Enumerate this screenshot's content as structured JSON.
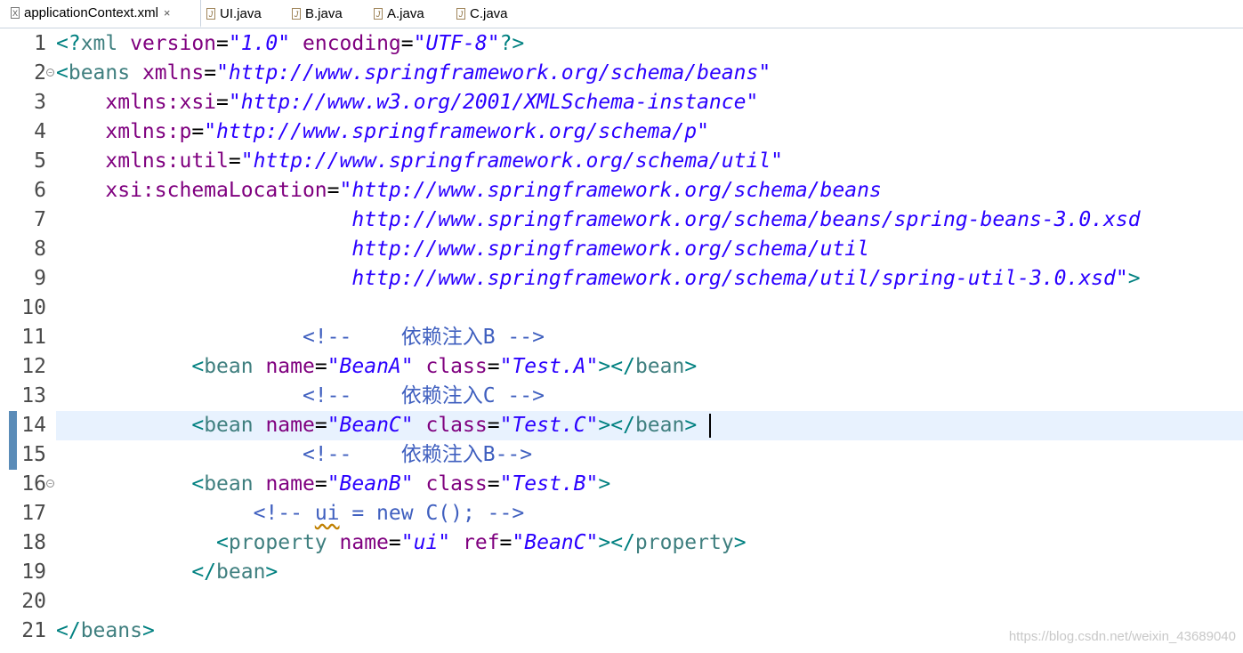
{
  "tabs": [
    {
      "label": "applicationContext.xml",
      "icon": "xml-file-icon",
      "active": true,
      "close": "×"
    },
    {
      "label": "UI.java",
      "icon": "java-file-icon"
    },
    {
      "label": "B.java",
      "icon": "java-file-icon"
    },
    {
      "label": "A.java",
      "icon": "java-file-icon"
    },
    {
      "label": "C.java",
      "icon": "java-file-icon"
    }
  ],
  "editor": {
    "current_line": 14,
    "line_numbers": [
      "1",
      "2",
      "3",
      "4",
      "5",
      "6",
      "7",
      "8",
      "9",
      "10",
      "11",
      "12",
      "13",
      "14",
      "15",
      "16",
      "17",
      "18",
      "19",
      "20",
      "21"
    ],
    "lines": [
      [
        [
          "bracket",
          "<?"
        ],
        [
          "tag",
          "xml "
        ],
        [
          "attr",
          "version"
        ],
        [
          "eq",
          "="
        ],
        [
          "str",
          "\"1.0\""
        ],
        [
          "plain",
          " "
        ],
        [
          "attr",
          "encoding"
        ],
        [
          "eq",
          "="
        ],
        [
          "str",
          "\"UTF-8\""
        ],
        [
          "bracket",
          "?>"
        ]
      ],
      [
        [
          "bracket",
          "<"
        ],
        [
          "tag",
          "beans "
        ],
        [
          "attr",
          "xmlns"
        ],
        [
          "eq",
          "="
        ],
        [
          "str",
          "\"http://www.springframework.org/schema/beans\""
        ]
      ],
      [
        [
          "plain",
          "    "
        ],
        [
          "attr",
          "xmlns:xsi"
        ],
        [
          "eq",
          "="
        ],
        [
          "str",
          "\"http://www.w3.org/2001/XMLSchema-instance\""
        ]
      ],
      [
        [
          "plain",
          "    "
        ],
        [
          "attr",
          "xmlns:p"
        ],
        [
          "eq",
          "="
        ],
        [
          "str",
          "\"http://www.springframework.org/schema/p\""
        ]
      ],
      [
        [
          "plain",
          "    "
        ],
        [
          "attr",
          "xmlns:util"
        ],
        [
          "eq",
          "="
        ],
        [
          "str",
          "\"http://www.springframework.org/schema/util\""
        ]
      ],
      [
        [
          "plain",
          "    "
        ],
        [
          "attr",
          "xsi:schemaLocation"
        ],
        [
          "eq",
          "="
        ],
        [
          "str",
          "\"http://www.springframework.org/schema/beans"
        ]
      ],
      [
        [
          "plain",
          "                        "
        ],
        [
          "str",
          "http://www.springframework.org/schema/beans/spring-beans-3.0.xsd"
        ]
      ],
      [
        [
          "plain",
          "                        "
        ],
        [
          "str",
          "http://www.springframework.org/schema/util"
        ]
      ],
      [
        [
          "plain",
          "                        "
        ],
        [
          "str",
          "http://www.springframework.org/schema/util/spring-util-3.0.xsd\""
        ],
        [
          "bracket",
          ">"
        ]
      ],
      [],
      [
        [
          "plain",
          "                    "
        ],
        [
          "comment",
          "<!--    依赖注入B -->"
        ]
      ],
      [
        [
          "plain",
          "           "
        ],
        [
          "bracket",
          "<"
        ],
        [
          "tag",
          "bean "
        ],
        [
          "attr",
          "name"
        ],
        [
          "eq",
          "="
        ],
        [
          "str",
          "\"BeanA\""
        ],
        [
          "plain",
          " "
        ],
        [
          "attr",
          "class"
        ],
        [
          "eq",
          "="
        ],
        [
          "str",
          "\"Test.A\""
        ],
        [
          "bracket",
          ">"
        ],
        [
          "bracket",
          "</"
        ],
        [
          "tag",
          "bean"
        ],
        [
          "bracket",
          ">"
        ]
      ],
      [
        [
          "plain",
          "                    "
        ],
        [
          "comment",
          "<!--    依赖注入C -->"
        ]
      ],
      [
        [
          "plain",
          "           "
        ],
        [
          "bracket",
          "<"
        ],
        [
          "tag",
          "bean "
        ],
        [
          "attr",
          "name"
        ],
        [
          "eq",
          "="
        ],
        [
          "str",
          "\"BeanC\""
        ],
        [
          "plain",
          " "
        ],
        [
          "attr",
          "class"
        ],
        [
          "eq",
          "="
        ],
        [
          "str",
          "\"Test.C\""
        ],
        [
          "bracket",
          ">"
        ],
        [
          "bracket",
          "</"
        ],
        [
          "tag",
          "bean"
        ],
        [
          "bracket",
          ">"
        ],
        [
          "plain",
          " "
        ],
        [
          "caret",
          ""
        ]
      ],
      [
        [
          "plain",
          "                    "
        ],
        [
          "comment",
          "<!--    依赖注入B-->"
        ]
      ],
      [
        [
          "plain",
          "           "
        ],
        [
          "bracket",
          "<"
        ],
        [
          "tag",
          "bean "
        ],
        [
          "attr",
          "name"
        ],
        [
          "eq",
          "="
        ],
        [
          "str",
          "\"BeanB\""
        ],
        [
          "plain",
          " "
        ],
        [
          "attr",
          "class"
        ],
        [
          "eq",
          "="
        ],
        [
          "str",
          "\"Test.B\""
        ],
        [
          "bracket",
          ">"
        ]
      ],
      [
        [
          "plain",
          "                "
        ],
        [
          "comment",
          "<!-- "
        ],
        [
          "squig",
          "ui"
        ],
        [
          "comment",
          " = new C(); -->"
        ]
      ],
      [
        [
          "plain",
          "             "
        ],
        [
          "bracket",
          "<"
        ],
        [
          "tag",
          "property "
        ],
        [
          "attr",
          "name"
        ],
        [
          "eq",
          "="
        ],
        [
          "str",
          "\"ui\""
        ],
        [
          "plain",
          " "
        ],
        [
          "attr",
          "ref"
        ],
        [
          "eq",
          "="
        ],
        [
          "str",
          "\"BeanC\""
        ],
        [
          "bracket",
          ">"
        ],
        [
          "bracket",
          "</"
        ],
        [
          "tag",
          "property"
        ],
        [
          "bracket",
          ">"
        ]
      ],
      [
        [
          "plain",
          "           "
        ],
        [
          "bracket",
          "</"
        ],
        [
          "tag",
          "bean"
        ],
        [
          "bracket",
          ">"
        ]
      ],
      [],
      [
        [
          "bracket",
          "</"
        ],
        [
          "tag",
          "beans"
        ],
        [
          "bracket",
          ">"
        ]
      ]
    ]
  },
  "watermark": "https://blog.csdn.net/weixin_43689040",
  "colors": {
    "tag_bracket": "#008080",
    "tag_name": "#3f7f7f",
    "attribute": "#7f007f",
    "string": "#2a00ff",
    "comment": "#3f5fbf",
    "current_line_bg": "#e8f2fe"
  }
}
